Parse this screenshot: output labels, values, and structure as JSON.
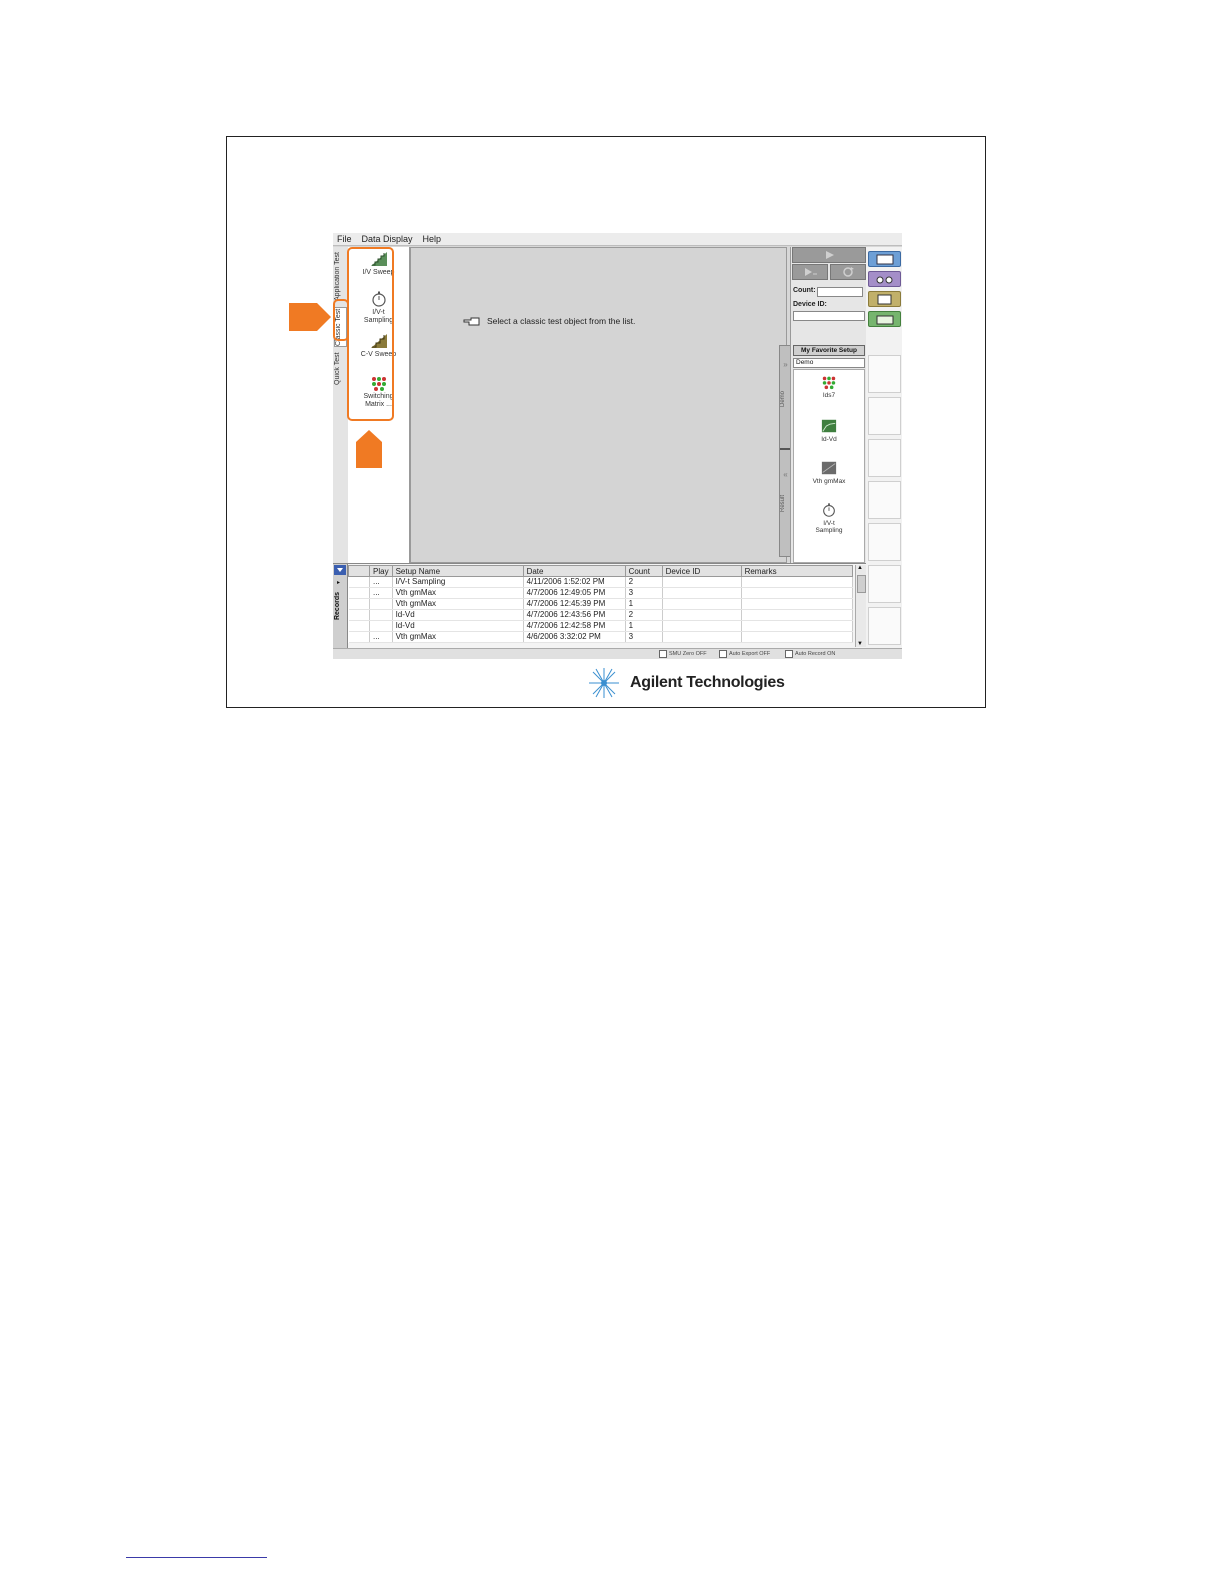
{
  "menu": [
    "File",
    "Data Display",
    "Help"
  ],
  "vertical_tabs": [
    "Application Test",
    "Classic Test",
    "Quick Test"
  ],
  "classic_tests": [
    {
      "label_lines": [
        "I/V Sweep"
      ],
      "icon": "sweep-staircase-icon"
    },
    {
      "label_lines": [
        "I/V-t",
        "Sampling"
      ],
      "icon": "stopwatch-icon"
    },
    {
      "label_lines": [
        "C-V Sweep"
      ],
      "icon": "cv-sweep-icon"
    },
    {
      "label_lines": [
        "Switching",
        "Matrix ..."
      ],
      "icon": "switching-matrix-icon"
    }
  ],
  "main": {
    "hint_text": "Select a classic test object from the list."
  },
  "side_strip": {
    "top_label": "Demo",
    "bottom_label": "Result"
  },
  "right_panel": {
    "count_label": "Count:",
    "device_id_label": "Device ID:",
    "favorites_button": "My Favorite Setup",
    "favorites_combo": "Demo",
    "favorites": [
      {
        "label_lines": [
          "Ids7"
        ],
        "icon": "switching-matrix-icon"
      },
      {
        "label_lines": [
          "Id-Vd"
        ],
        "icon": "id-vd-icon"
      },
      {
        "label_lines": [
          "Vth gmMax"
        ],
        "icon": "vth-gmmax-icon"
      },
      {
        "label_lines": [
          "I/V-t",
          "Sampling"
        ],
        "icon": "stopwatch-icon"
      }
    ]
  },
  "records": {
    "title": "Records",
    "columns": [
      "Play",
      "Setup Name",
      "Date",
      "Count",
      "Device ID",
      "Remarks"
    ],
    "rows": [
      {
        "play": "...",
        "setup": "I/V-t Sampling",
        "date": "4/11/2006 1:52:02 PM",
        "count": "2",
        "device": "",
        "remarks": ""
      },
      {
        "play": "...",
        "setup": "Vth gmMax",
        "date": "4/7/2006 12:49:05 PM",
        "count": "3",
        "device": "",
        "remarks": ""
      },
      {
        "play": "",
        "setup": "Vth gmMax",
        "date": "4/7/2006 12:45:39 PM",
        "count": "1",
        "device": "",
        "remarks": ""
      },
      {
        "play": "",
        "setup": "Id-Vd",
        "date": "4/7/2006 12:43:56 PM",
        "count": "2",
        "device": "",
        "remarks": ""
      },
      {
        "play": "",
        "setup": "Id-Vd",
        "date": "4/7/2006 12:42:58 PM",
        "count": "1",
        "device": "",
        "remarks": ""
      },
      {
        "play": "...",
        "setup": "Vth gmMax",
        "date": "4/6/2006 3:32:02 PM",
        "count": "3",
        "device": "",
        "remarks": ""
      }
    ]
  },
  "status": [
    "SMU Zero OFF",
    "Auto Export OFF",
    "Auto Record ON"
  ],
  "footer": {
    "brand": "Agilent Technologies"
  },
  "colors": {
    "highlight": "#f07a23",
    "accent_blue": "#3a3aa8"
  }
}
